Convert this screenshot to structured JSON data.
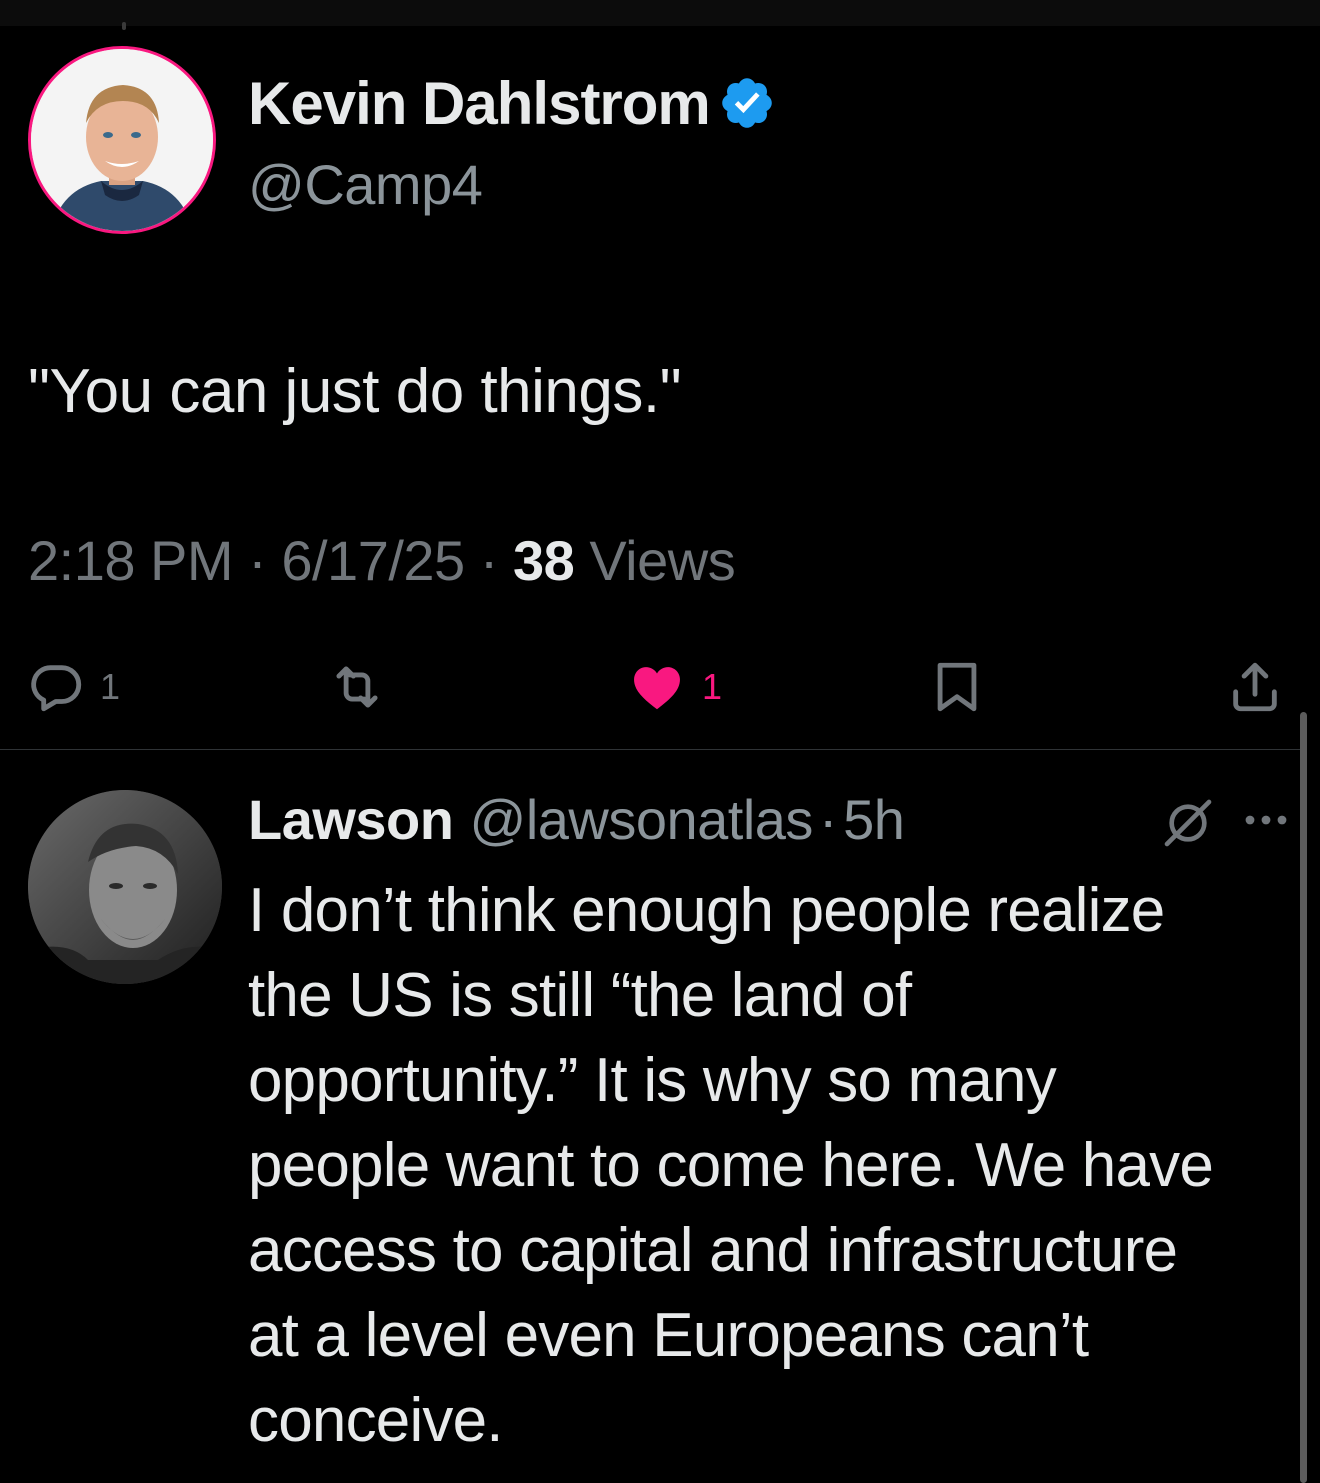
{
  "main_tweet": {
    "author": {
      "name": "Kevin Dahlstrom",
      "handle": "@Camp4",
      "verified": true
    },
    "text": "\"You can just do things.\"",
    "meta": {
      "time": "2:18 PM",
      "separator": "·",
      "date": "6/17/25",
      "views_count": "38",
      "views_label": "Views"
    },
    "actions": {
      "replies": "1",
      "reposts": "",
      "likes": "1",
      "liked": true
    }
  },
  "reply": {
    "author": {
      "name": "Lawson",
      "handle": "@lawsonatlas"
    },
    "separator": "·",
    "time": "5h",
    "text": "I don’t think enough people realize\nthe US is still “the land of\nopportunity.” It is why so many\npeople want to come here. We have\naccess to capital and infrastructure\nat a level even Europeans can’t\nconceive."
  },
  "icons": {
    "verified": "verified-badge-icon",
    "reply": "reply-icon",
    "repost": "repost-icon",
    "like": "heart-icon",
    "bookmark": "bookmark-icon",
    "share": "share-icon",
    "grok": "grok-icon",
    "more": "more-icon"
  },
  "colors": {
    "background": "#000000",
    "text_primary": "#e7e9ea",
    "text_secondary": "#71767b",
    "verified_blue": "#1d9bf0",
    "like_pink": "#f91880",
    "divider": "#2f3336"
  }
}
